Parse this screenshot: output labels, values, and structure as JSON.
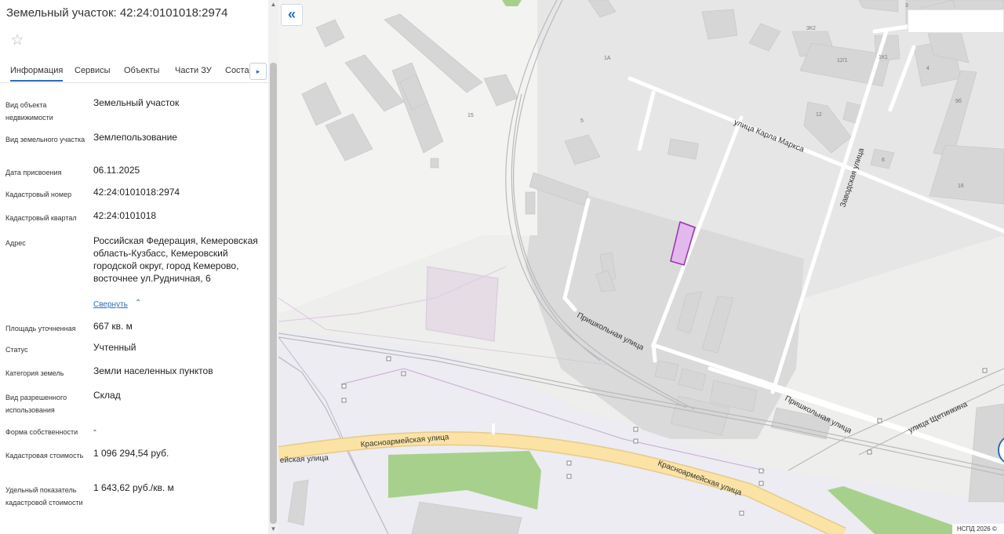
{
  "panel": {
    "title": "Земельный участок: 42:24:0101018:2974",
    "star_icon": "☆",
    "tabs": [
      "Информация",
      "Сервисы",
      "Объекты",
      "Части ЗУ",
      "Состав"
    ],
    "active_tab": "Информация",
    "tab_scroll_icon": "▸",
    "fields": [
      {
        "label": "Вид объекта недвижимости",
        "value": "Земельный участок"
      },
      {
        "label": "Вид земельного участка",
        "value": "Землепользование"
      },
      {
        "label": "Дата присвоения",
        "value": "06.11.2025"
      },
      {
        "label": "Кадастровый номер",
        "value": "42:24:0101018:2974"
      },
      {
        "label": "Кадастровый квартал",
        "value": "42:24:0101018"
      },
      {
        "label": "Адрес",
        "value": "Российская Федерация, Кемеровская область-Кузбасс, Кемеровский городской округ, город Кемерово, восточнее ул.Рудничная, 6"
      },
      {
        "label": "Площадь уточненная",
        "value": "667 кв. м"
      },
      {
        "label": "Статус",
        "value": "Учтенный"
      },
      {
        "label": "Категория земель",
        "value": "Земли населенных пунктов"
      },
      {
        "label": "Вид разрешенного использования",
        "value": "Склад"
      },
      {
        "label": "Форма собственности",
        "value": "-"
      },
      {
        "label": "Кадастровая стоимость",
        "value": "1 096 294,54 руб."
      },
      {
        "label": "Удельный показатель кадастровой стоимости",
        "value": "1 643,62 руб./кв. м"
      }
    ],
    "collapse_link": "Свернуть",
    "collapse_icon": "⌃"
  },
  "map": {
    "collapse_button_icon": "«",
    "attribution": "НСПД 2026 ©",
    "streets": {
      "karla_marksa": "улица Карла Маркса",
      "zavodskaya": "Заводская улица",
      "prishkolnaya_1": "Пришкольная улица",
      "prishkolnaya_2": "Пришкольная улица",
      "krasnoarmeyskaya_1": "Красноармейская улица",
      "krasnoarmeyskaya_2": "Красноармейская улица",
      "krasnoarmeyskaya_left": "ейская улица",
      "schetinkina": "улица Щетинкина"
    },
    "house_numbers": [
      "15",
      "1А",
      "5",
      "3К2",
      "12/1",
      "1К1",
      "3",
      "4",
      "12",
      "9б",
      "6",
      "16"
    ],
    "colors": {
      "parcel_fill": "#e3b8ec",
      "parcel_stroke": "#9a2fb0",
      "main_road": "#fbe3a6",
      "greenery": "#a8d08d",
      "building": "#d8d8d8",
      "accent": "#2b6cb8"
    }
  }
}
